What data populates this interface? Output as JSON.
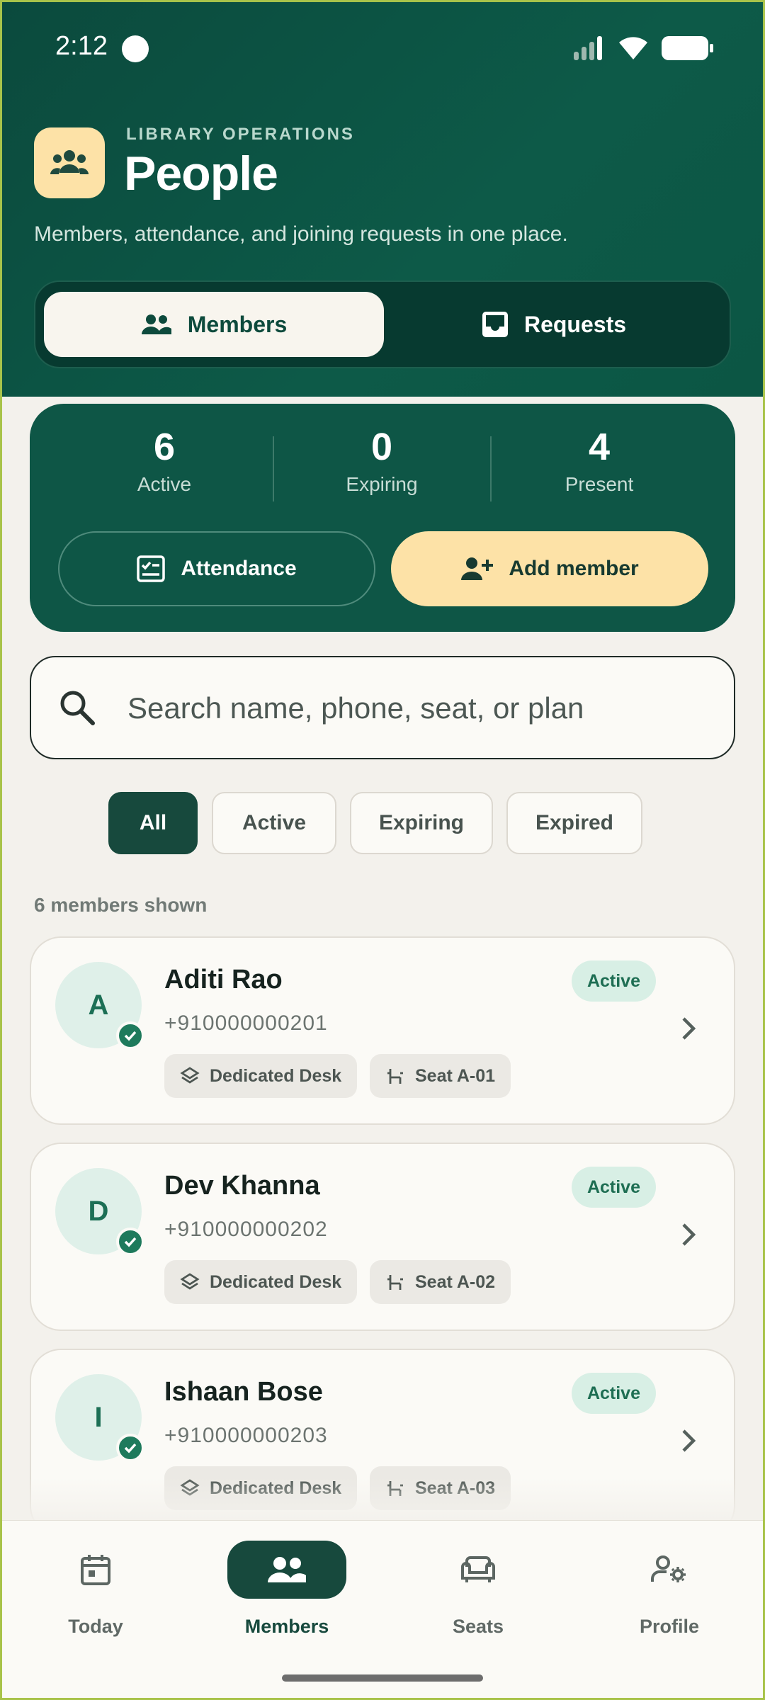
{
  "status_bar": {
    "time": "2:12"
  },
  "header": {
    "eyebrow": "LIBRARY OPERATIONS",
    "title": "People",
    "subtitle": "Members, attendance, and joining requests in one place.",
    "app_icon": "group-icon",
    "tabs": [
      {
        "label": "Members",
        "icon": "people-icon",
        "selected": true
      },
      {
        "label": "Requests",
        "icon": "inbox-icon",
        "selected": false
      }
    ]
  },
  "stats": {
    "items": [
      {
        "value": "6",
        "label": "Active"
      },
      {
        "value": "0",
        "label": "Expiring"
      },
      {
        "value": "4",
        "label": "Present"
      }
    ],
    "attendance_label": "Attendance",
    "add_member_label": "Add member"
  },
  "search": {
    "placeholder": "Search name, phone, seat, or plan"
  },
  "filters": [
    {
      "label": "All",
      "selected": true
    },
    {
      "label": "Active",
      "selected": false
    },
    {
      "label": "Expiring",
      "selected": false
    },
    {
      "label": "Expired",
      "selected": false
    }
  ],
  "member_count": "6 members shown",
  "members": [
    {
      "initial": "A",
      "name": "Aditi Rao",
      "phone": "+910000000201",
      "status": "Active",
      "plan": "Dedicated Desk",
      "seat": "Seat A-01"
    },
    {
      "initial": "D",
      "name": "Dev Khanna",
      "phone": "+910000000202",
      "status": "Active",
      "plan": "Dedicated Desk",
      "seat": "Seat A-02"
    },
    {
      "initial": "I",
      "name": "Ishaan Bose",
      "phone": "+910000000203",
      "status": "Active",
      "plan": "Dedicated Desk",
      "seat": "Seat A-03"
    }
  ],
  "nav": [
    {
      "label": "Today",
      "icon": "calendar-icon",
      "selected": false
    },
    {
      "label": "Members",
      "icon": "people-icon",
      "selected": true
    },
    {
      "label": "Seats",
      "icon": "sofa-icon",
      "selected": false
    },
    {
      "label": "Profile",
      "icon": "user-settings-icon",
      "selected": false
    }
  ],
  "colors": {
    "header_bg": "#0b4a3d",
    "accent": "#17493d",
    "highlight": "#fde2a7",
    "active_badge": "#d8efe5"
  }
}
